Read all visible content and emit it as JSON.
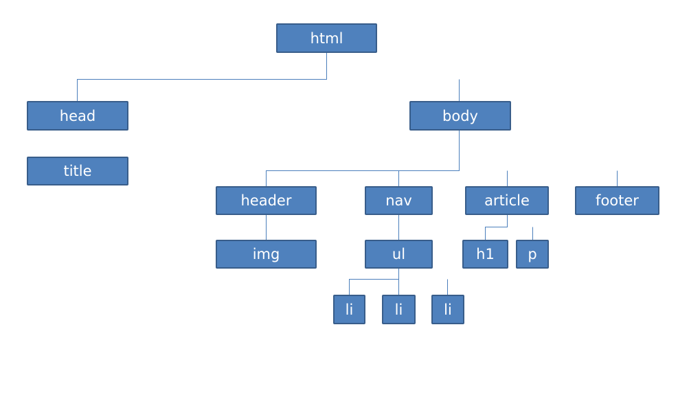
{
  "diagram": {
    "colors": {
      "fill": "#4f81bd",
      "border": "#385d8a",
      "connector": "#4a7ebb",
      "text": "#ffffff"
    },
    "nodes": {
      "html": "html",
      "head": "head",
      "title": "title",
      "body": "body",
      "header": "header",
      "nav": "nav",
      "article": "article",
      "footer": "footer",
      "img": "img",
      "ul": "ul",
      "h1": "h1",
      "p": "p",
      "li1": "li",
      "li2": "li",
      "li3": "li"
    },
    "edges": [
      [
        "html",
        "head"
      ],
      [
        "html",
        "body"
      ],
      [
        "body",
        "header"
      ],
      [
        "body",
        "nav"
      ],
      [
        "body",
        "article"
      ],
      [
        "body",
        "footer"
      ],
      [
        "header",
        "img"
      ],
      [
        "nav",
        "ul"
      ],
      [
        "article",
        "h1"
      ],
      [
        "article",
        "p"
      ],
      [
        "ul",
        "li1"
      ],
      [
        "ul",
        "li2"
      ],
      [
        "ul",
        "li3"
      ]
    ]
  }
}
